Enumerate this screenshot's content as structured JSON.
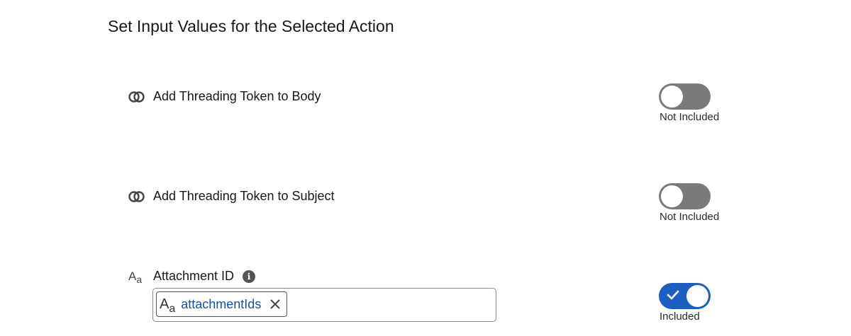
{
  "page_title": "Set Input Values for the Selected Action",
  "rows": [
    {
      "label": "Add Threading Token to Body",
      "icon": "link-rings-icon",
      "toggle_state": "off",
      "status": "Not Included"
    },
    {
      "label": "Add Threading Token to Subject",
      "icon": "link-rings-icon",
      "toggle_state": "off",
      "status": "Not Included"
    },
    {
      "label": "Attachment ID",
      "icon": "text-type-icon",
      "info_icon": "info-icon",
      "toggle_state": "on",
      "status": "Included",
      "field": {
        "pill_text": "attachmentIds",
        "pill_icon": "text-type-icon"
      }
    }
  ],
  "type_icon_glyph": {
    "big": "A",
    "small": "a"
  },
  "info_glyph": "i",
  "colors": {
    "toggle_on": "#1b5fc1",
    "toggle_off": "#7a7a7a",
    "pill_text": "#1b4f9e"
  }
}
